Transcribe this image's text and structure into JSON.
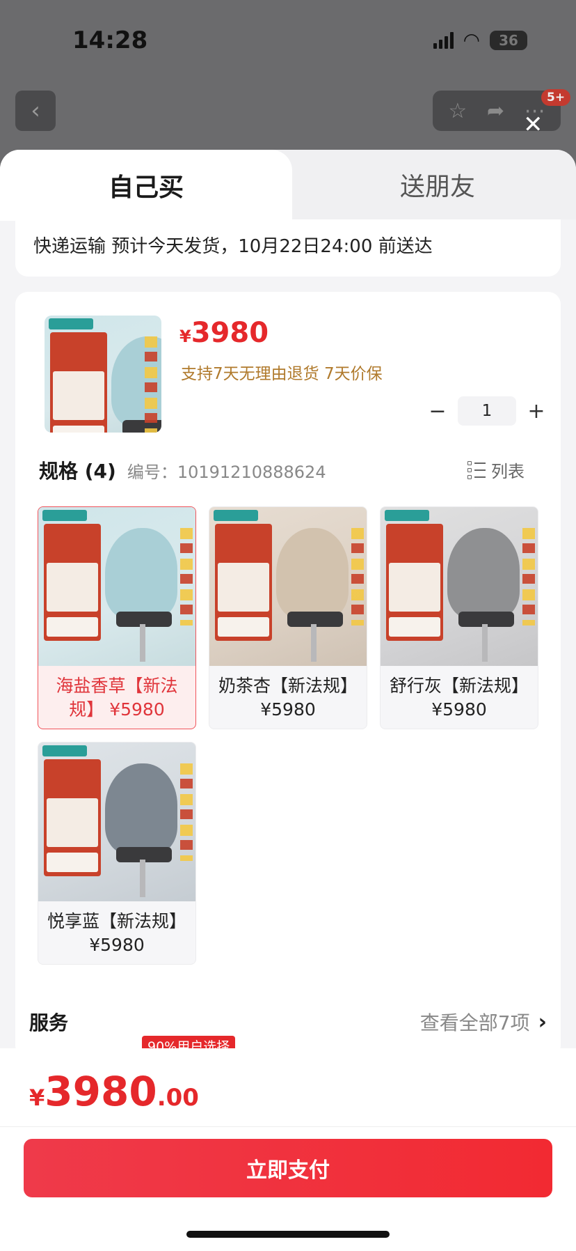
{
  "status_bar": {
    "time": "14:28",
    "battery": "36"
  },
  "header": {
    "badge": "5+"
  },
  "tabs": [
    {
      "label": "自己买",
      "active": true
    },
    {
      "label": "送朋友",
      "active": false
    }
  ],
  "shipping": {
    "text": "快递运输 预计今天发货，10月22日24:00 前送达"
  },
  "product": {
    "currency": "¥",
    "price": "3980",
    "policy": "支持7天无理由退货  7天价保",
    "quantity": "1",
    "minus": "−",
    "plus": "+"
  },
  "spec": {
    "title": "规格 (4)",
    "code": "编号：10191210888624",
    "list_label": "列表",
    "options": [
      {
        "label": "海盐香草【新法规】 ¥5980",
        "selected": true,
        "color": "#a9cfd6"
      },
      {
        "label": "奶茶杏【新法规】 ¥5980",
        "selected": false,
        "color": "#d2c2ae"
      },
      {
        "label": "舒行灰【新法规】 ¥5980",
        "selected": false,
        "color": "#8f9092"
      },
      {
        "label": "悦享蓝【新法规】 ¥5980",
        "selected": false,
        "color": "#7d8791"
      }
    ]
  },
  "services": {
    "title": "服务",
    "more": "查看全部7项",
    "badge": "90%用户选择"
  },
  "footer": {
    "currency": "¥",
    "total_int": "3980",
    "total_dec": ".00",
    "pay_label": "立即支付"
  },
  "colors": {
    "accent": "#e5282b",
    "policy": "#b07a2c",
    "selected_border": "#f0535a"
  }
}
